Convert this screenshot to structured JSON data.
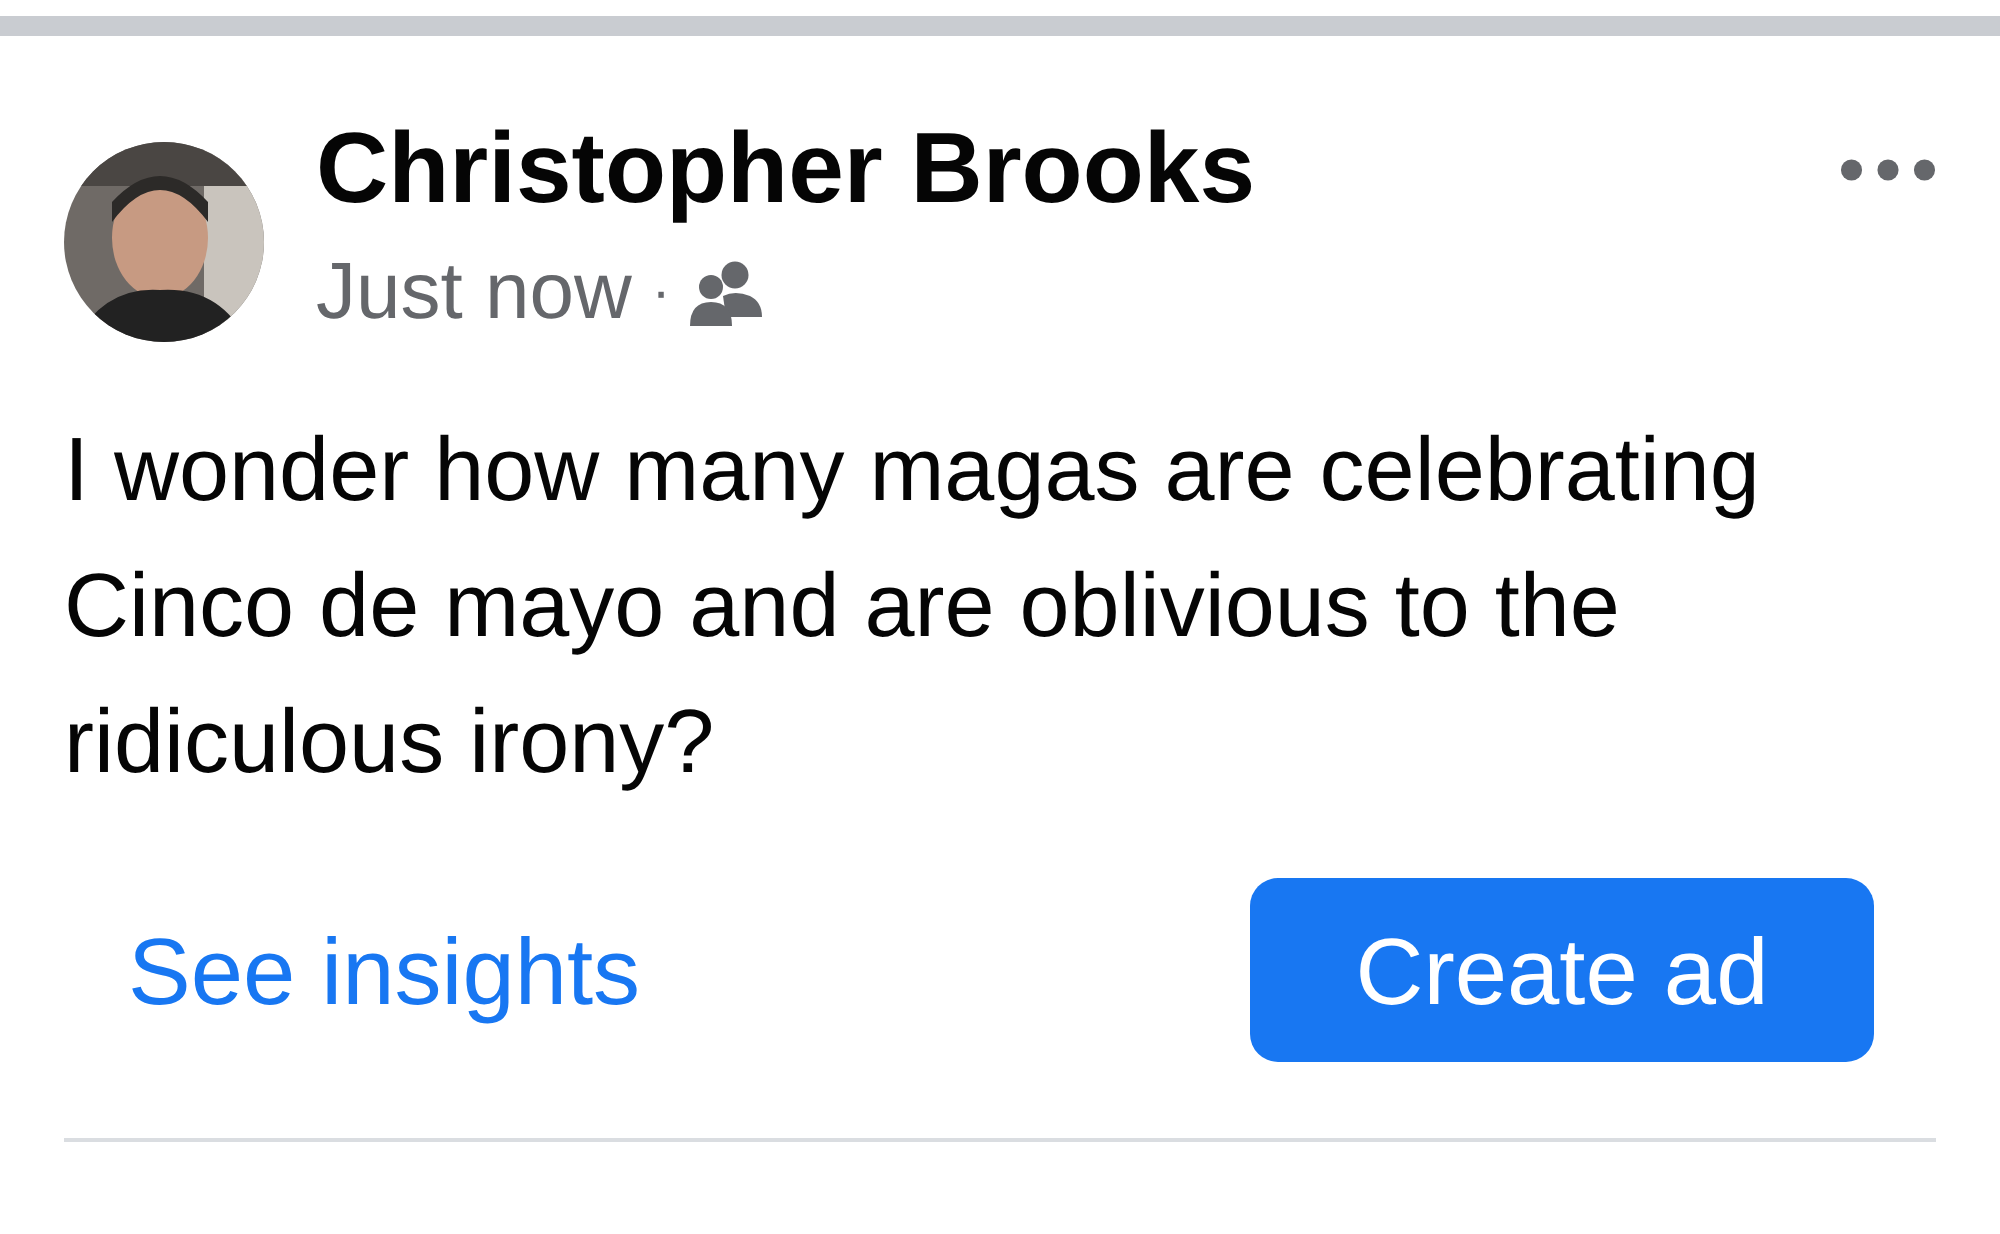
{
  "post": {
    "author": "Christopher Brooks",
    "time": "Just now",
    "separator": "·",
    "text": "I wonder how many magas are celebrating Cinco de mayo and are oblivious to the ridiculous irony?"
  },
  "actions": {
    "link": "See insights",
    "button": "Create ad"
  }
}
